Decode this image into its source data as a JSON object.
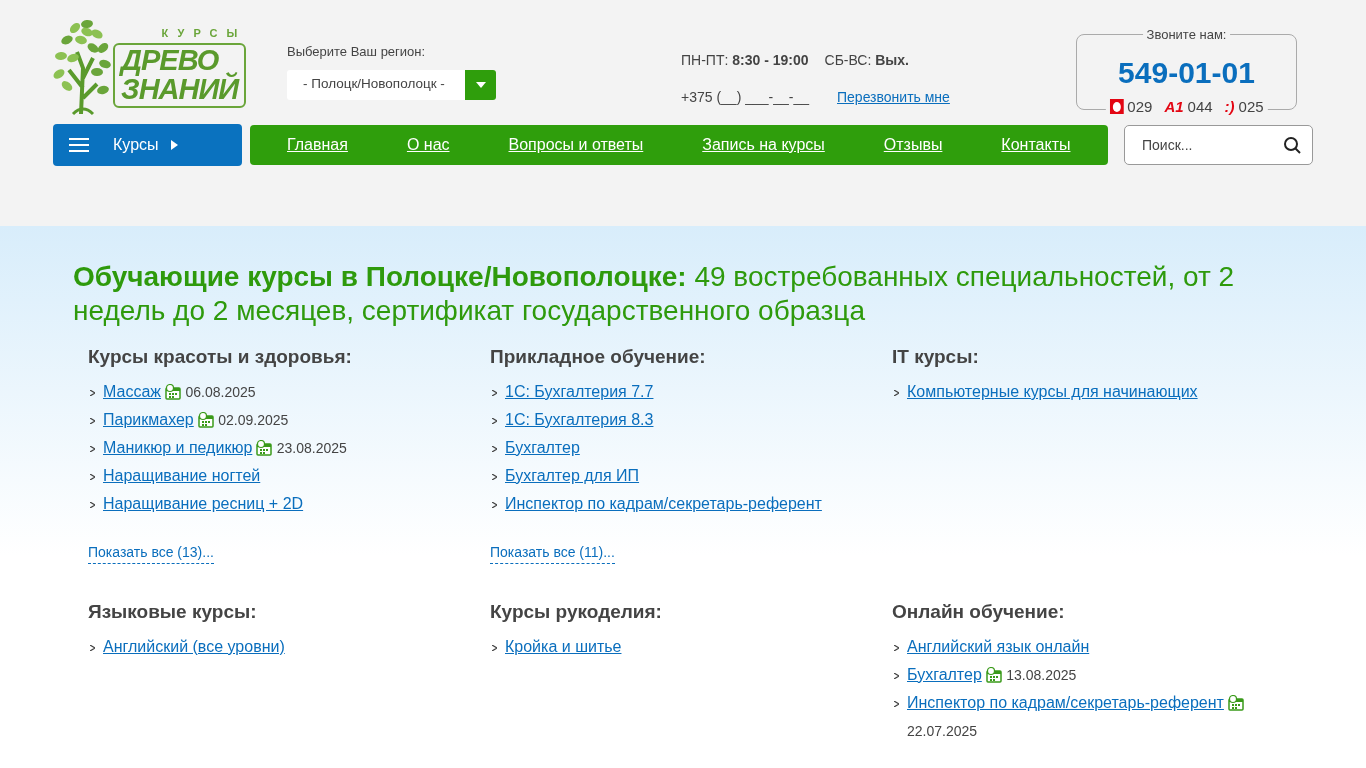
{
  "logo": {
    "small": "КУРСЫ",
    "line1": "ДРЕВО",
    "line2": "ЗНАНИЙ"
  },
  "region": {
    "label": "Выберите Ваш регион:",
    "value": "- Полоцк/Новополоцк -"
  },
  "hours": [
    {
      "label": "ПН-ПТ:",
      "value": "8:30 - 19:00"
    },
    {
      "label": "СБ-ВС:",
      "value": "Вых."
    }
  ],
  "callback": {
    "placeholder": "+375 (__) ___-__-__",
    "link": "Перезвонить мне"
  },
  "contact": {
    "title": "Звоните нам:",
    "phone": "549-01-01",
    "operators": [
      {
        "kind": "drop",
        "code": "029"
      },
      {
        "kind": "text",
        "glyph": "A1",
        "code": "044"
      },
      {
        "kind": "text",
        "glyph": ":)",
        "code": "025"
      }
    ]
  },
  "courses_button": "Курсы",
  "nav": [
    {
      "label": "Главная"
    },
    {
      "label": "О нас"
    },
    {
      "label": "Вопросы и ответы"
    },
    {
      "label": "Запись на курсы"
    },
    {
      "label": "Отзывы"
    },
    {
      "label": "Контакты"
    }
  ],
  "search": {
    "placeholder": "Поиск..."
  },
  "headline": "**Обучающие курсы в Полоцке/Новополоцке:** 49 востребованных специальностей, от 2 недель до 2 месяцев, сертификат государственного образца",
  "categories": [
    {
      "title": "Курсы красоты и здоровья:",
      "items": [
        {
          "name": "Массаж",
          "date": "06.08.2025"
        },
        {
          "name": "Парикмахер",
          "date": "02.09.2025"
        },
        {
          "name": "Маникюр и педикюр",
          "date": "23.08.2025"
        },
        {
          "name": "Наращивание ногтей"
        },
        {
          "name": "Наращивание ресниц + 2D"
        }
      ],
      "show_all": "Показать все (13)..."
    },
    {
      "title": "Прикладное обучение:",
      "items": [
        {
          "name": "1С: Бухгалтерия 7.7"
        },
        {
          "name": "1С: Бухгалтерия 8.3"
        },
        {
          "name": "Бухгалтер"
        },
        {
          "name": "Бухгалтер для ИП"
        },
        {
          "name": "Инспектор по кадрам/секретарь-референт"
        }
      ],
      "show_all": "Показать все (11)..."
    },
    {
      "title": "IT курсы:",
      "items": [
        {
          "name": "Компьютерные курсы для начинающих"
        }
      ]
    },
    {
      "title": "Языковые курсы:",
      "items": [
        {
          "name": "Английский (все уровни)"
        }
      ]
    },
    {
      "title": "Курсы рукоделия:",
      "items": [
        {
          "name": "Кройка и шитье"
        }
      ]
    },
    {
      "title": "Онлайн обучение:",
      "items": [
        {
          "name": "Английский язык онлайн"
        },
        {
          "name": "Бухгалтер",
          "date": "13.08.2025"
        },
        {
          "name": "Инспектор по кадрам/секретарь-референт",
          "date": "22.07.2025"
        }
      ]
    }
  ]
}
